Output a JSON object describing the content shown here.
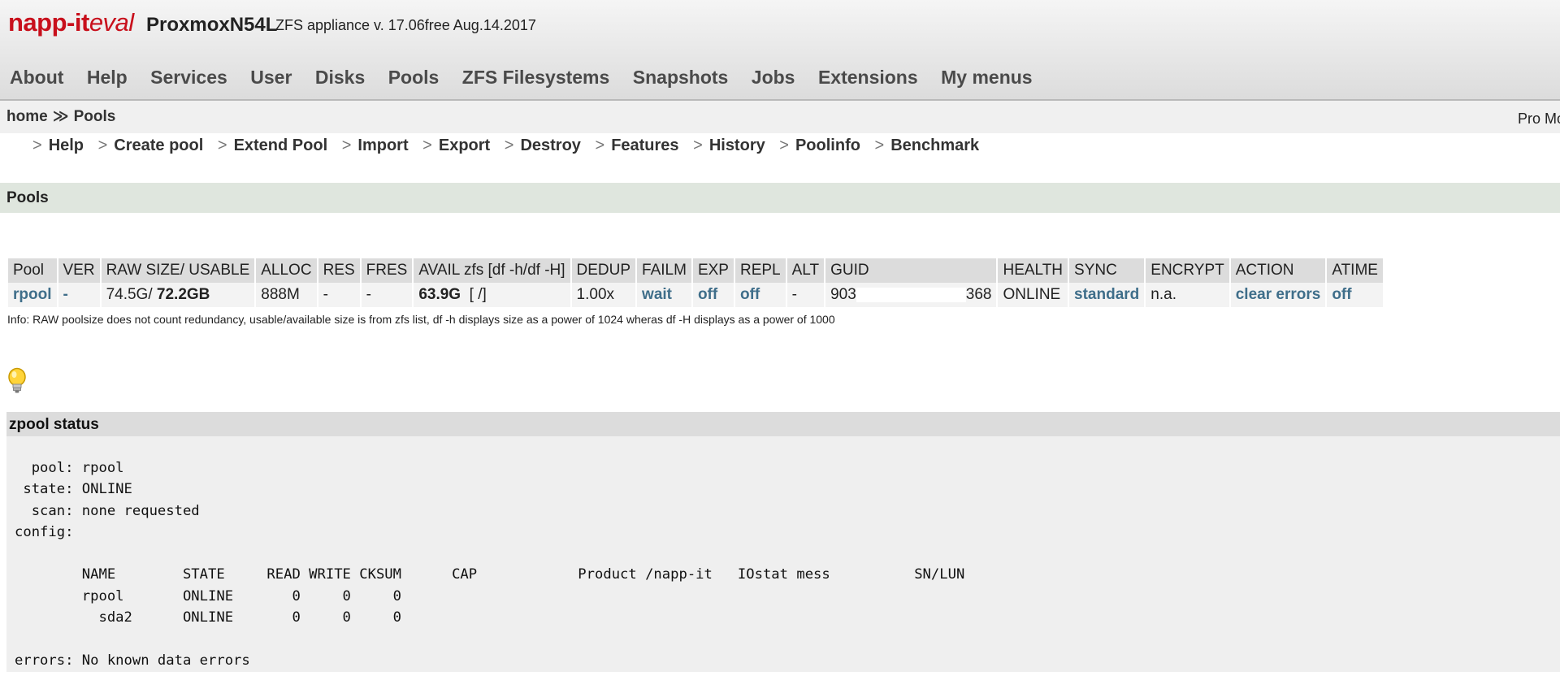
{
  "app": {
    "logo_part1": "napp-it",
    "logo_part2": "eval",
    "hostname": "ProxmoxN54L",
    "appliance": "ZFS appliance v. 17.06free Aug.14.2017"
  },
  "topnav": [
    "About",
    "Help",
    "Services",
    "User",
    "Disks",
    "Pools",
    "ZFS Filesystems",
    "Snapshots",
    "Jobs",
    "Extensions",
    "My menus"
  ],
  "breadcrumb": {
    "home": "home",
    "separator": "≫",
    "current": "Pools"
  },
  "promo": "Pro Mo",
  "submenu": {
    "arrow": ">",
    "items": [
      "Help",
      "Create pool",
      "Extend Pool",
      "Import",
      "Export",
      "Destroy",
      "Features",
      "History",
      "Poolinfo",
      "Benchmark"
    ]
  },
  "section_title": "Pools",
  "pool_table": {
    "headers": [
      "Pool",
      "VER",
      "RAW SIZE/ USABLE",
      "ALLOC",
      "RES",
      "FRES",
      "AVAIL zfs [df -h/df -H]",
      "DEDUP",
      "FAILM",
      "EXP",
      "REPL",
      "ALT",
      "GUID",
      "HEALTH",
      "SYNC",
      "ENCRYPT",
      "ACTION",
      "ATIME"
    ],
    "row": {
      "pool": "rpool",
      "ver": "-",
      "raw": "74.5G/",
      "usable": "72.2GB",
      "alloc": "888M",
      "res": "-",
      "fres": "-",
      "avail": "63.9G",
      "avail_df": "[ /]",
      "dedup": "1.00x",
      "failm": "wait",
      "exp": "off",
      "repl": "off",
      "alt": "-",
      "guid_start": "903",
      "guid_end": "368",
      "health": "ONLINE",
      "sync": "standard",
      "encrypt": "n.a.",
      "action": "clear errors",
      "atime": "off"
    }
  },
  "info_text": "Info: RAW poolsize does not count redundancy, usable/available size is from zfs list, df -h displays size as a power of 1024 wheras df -H displays as a power of 1000",
  "status": {
    "title": "zpool status",
    "text": "  pool: rpool\n state: ONLINE\n  scan: none requested\nconfig:\n\n        NAME        STATE     READ WRITE CKSUM      CAP            Product /napp-it   IOstat mess          SN/LUN\n        rpool       ONLINE       0     0     0\n          sda2      ONLINE       0     0     0\n\nerrors: No known data errors"
  },
  "colors": {
    "logo": "#c8101c",
    "link": "#3f6e8a",
    "section_bar": "#dfe6de",
    "header_gray": "#dcdcdc"
  },
  "icons": [
    "lightbulb-icon"
  ]
}
